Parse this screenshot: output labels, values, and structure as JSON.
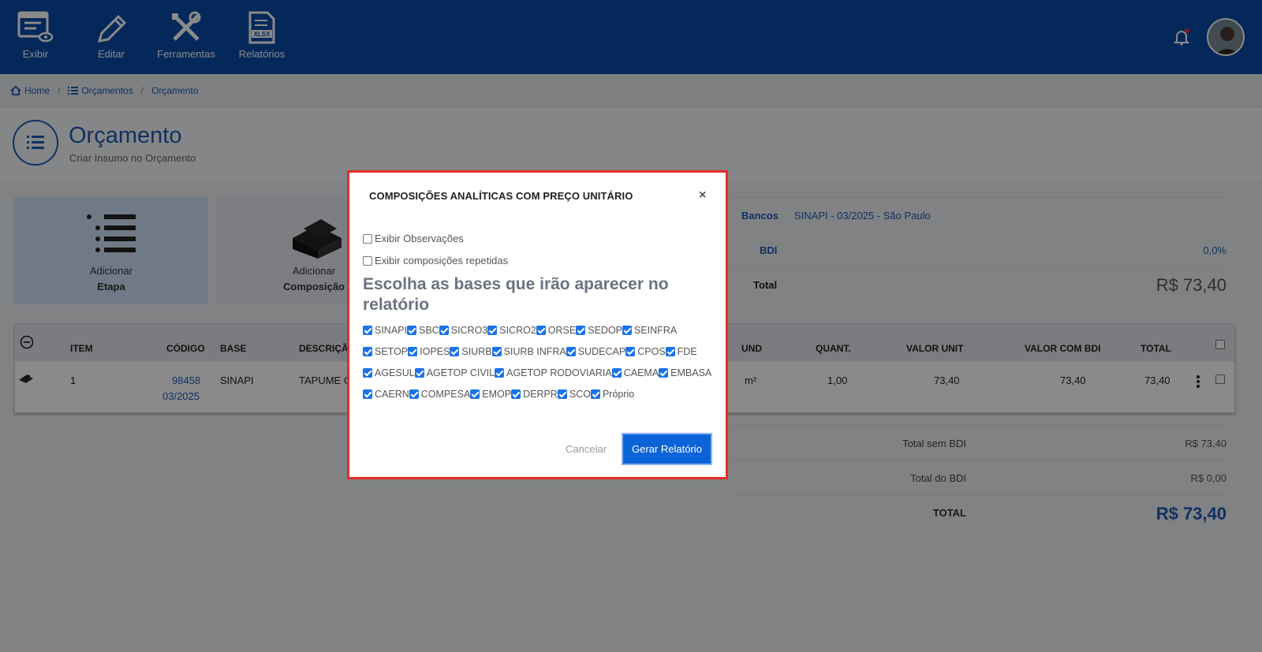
{
  "toolbar": {
    "items": [
      {
        "label": "Exibir",
        "icon": "view-list-icon"
      },
      {
        "label": "Editar",
        "icon": "pencil-icon"
      },
      {
        "label": "Ferramentas",
        "icon": "tools-icon"
      },
      {
        "label": "Relatórios",
        "icon": "xlsx-file-icon"
      }
    ]
  },
  "breadcrumb": {
    "home": "Home",
    "orcamentos": "Orçamentos",
    "orcamento": "Orçamento",
    "sep": "/"
  },
  "page": {
    "title": "Orçamento",
    "subtitle": "Criar Insumo no Orçamento"
  },
  "cards": [
    {
      "line1": "Adicionar",
      "line2": "Etapa"
    },
    {
      "line1": "Adicionar",
      "line2": "Composição"
    }
  ],
  "summary": {
    "bancos_label": "Bancos",
    "bancos_value": "SINAPI - 03/2025 - São Paulo",
    "bdi_label": "BDI",
    "bdi_value": "0,0%",
    "total_label": "Total",
    "total_value": "R$ 73,40"
  },
  "table": {
    "headers": {
      "item": "ITEM",
      "codigo": "CÓDIGO",
      "base": "BASE",
      "descricao": "DESCRIÇÃO",
      "und": "UND",
      "quant": "QUANT.",
      "valor_unit": "VALOR UNIT",
      "valor_bdi": "VALOR COM BDI",
      "total": "TOTAL"
    },
    "row": {
      "item": "1",
      "codigo": "98458",
      "data": "03/2025",
      "base": "SINAPI",
      "descricao": "TAPUME C",
      "und": "m²",
      "quant": "1,00",
      "valor_unit": "73,40",
      "valor_bdi": "73,40",
      "total": "73,40"
    }
  },
  "totals": {
    "sem_bdi_label": "Total sem BDI",
    "sem_bdi_value": "R$ 73,40",
    "do_bdi_label": "Total do BDI",
    "do_bdi_value": "R$ 0,00",
    "total_label": "TOTAL",
    "total_value": "R$ 73,40"
  },
  "modal": {
    "title": "COMPOSIÇÕES ANALÍTICAS COM PREÇO UNITÁRIO",
    "close": "×",
    "opt_observacoes": "Exibir Observações",
    "opt_repetidas": "Exibir composições repetidas",
    "bases_heading": "Escolha as bases que irão aparecer no relatório",
    "bases": [
      [
        "SINAPI",
        "SBC",
        "SICRO3",
        "SICRO2",
        "ORSE",
        "SEDOP",
        "SEINFRA"
      ],
      [
        "SETOP",
        "IOPES",
        "SIURB",
        "SIURB INFRA",
        "SUDECAP",
        "CPOS",
        "FDE"
      ],
      [
        "AGESUL",
        "AGETOP CIVIL",
        "AGETOP RODOVIARIA",
        "CAEMA",
        "EMBASA"
      ],
      [
        "CAERN",
        "COMPESA",
        "EMOP",
        "DERPR",
        "SCO",
        "Próprio"
      ]
    ],
    "cancel": "Cancelar",
    "submit": "Gerar Relatório"
  }
}
